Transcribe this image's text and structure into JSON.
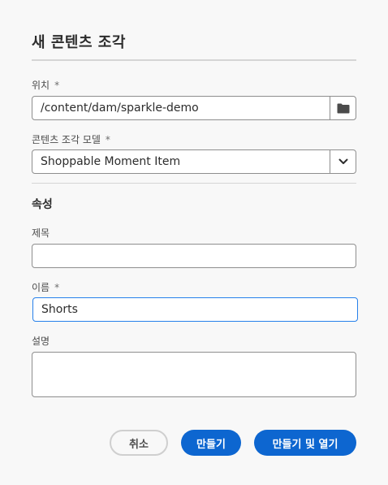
{
  "dialog": {
    "title": "새 콘텐츠 조각"
  },
  "location": {
    "label": "위치",
    "required_mark": "*",
    "value": "/content/dam/sparkle-demo",
    "icon": "folder-icon"
  },
  "model": {
    "label": "콘텐츠 조각 모델",
    "required_mark": "*",
    "selected": "Shoppable Moment Item",
    "icon": "chevron-down-icon"
  },
  "properties": {
    "heading": "속성",
    "title_field": {
      "label": "제목",
      "value": ""
    },
    "name_field": {
      "label": "이름",
      "required_mark": "*",
      "value": "Shorts"
    },
    "description_field": {
      "label": "설명",
      "value": ""
    }
  },
  "buttons": {
    "cancel": "취소",
    "create": "만들기",
    "create_open": "만들기 및 열기"
  },
  "colors": {
    "accent": "#0d66d0",
    "focus": "#2680eb",
    "background": "#f8f8f8"
  }
}
